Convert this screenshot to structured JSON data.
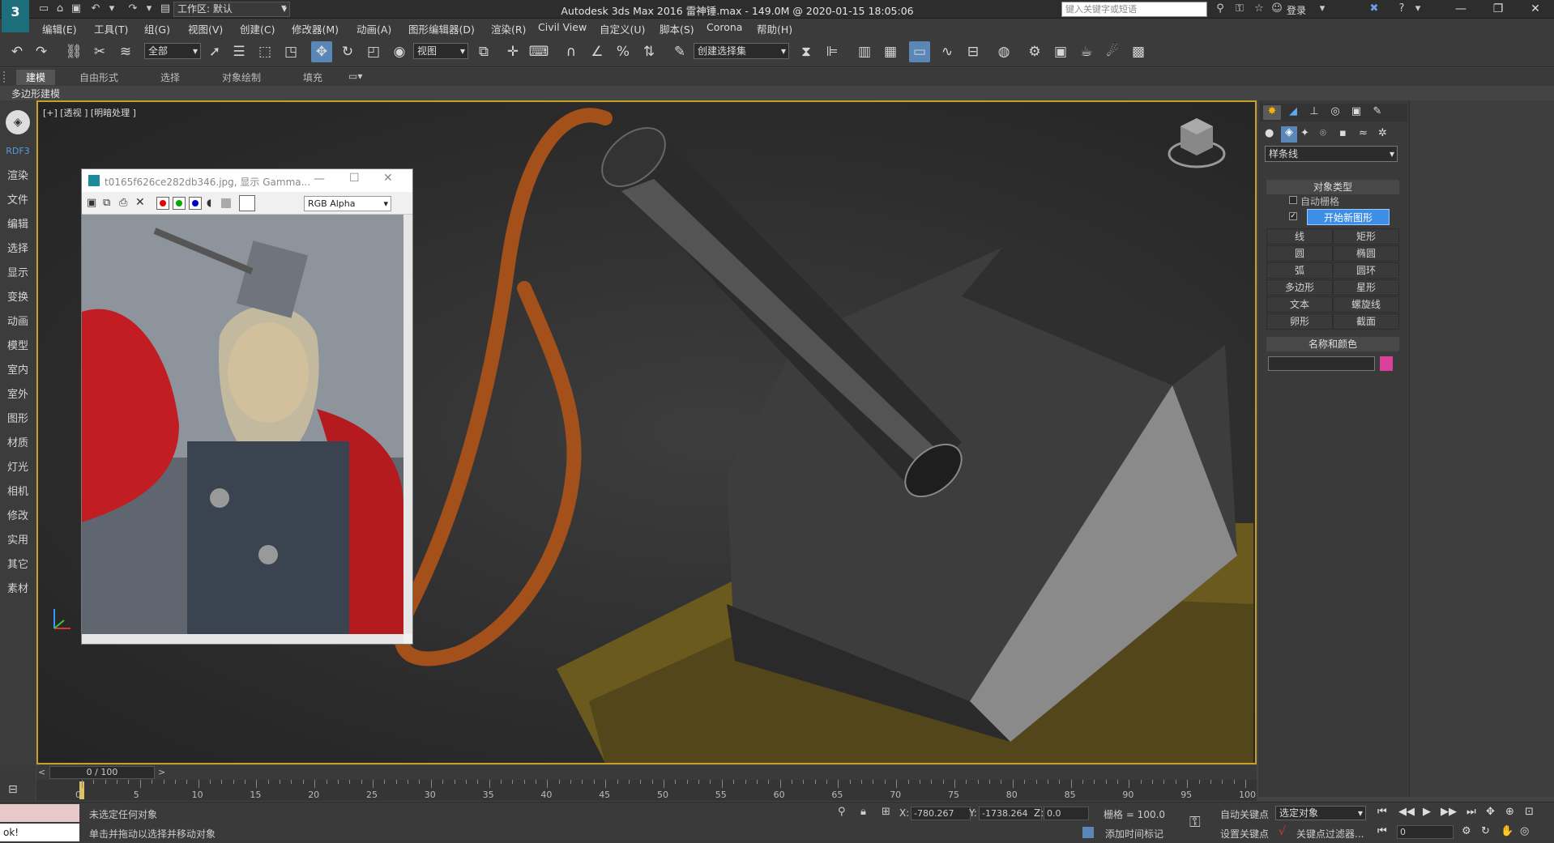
{
  "titlebar": {
    "workspace": "工作区: 默认",
    "title": "Autodesk 3ds Max 2016     雷神锤.max - 149.0M @ 2020-01-15 18:05:06",
    "search_placeholder": "键入关键字或短语",
    "login": "登录"
  },
  "menubar": [
    "编辑(E)",
    "工具(T)",
    "组(G)",
    "视图(V)",
    "创建(C)",
    "修改器(M)",
    "动画(A)",
    "图形编辑器(D)",
    "渲染(R)",
    "Civil View",
    "自定义(U)",
    "脚本(S)",
    "Corona",
    "帮助(H)"
  ],
  "toolbar": {
    "filter_select": "全部",
    "ref_coord": "视图",
    "named_sel": "创建选择集"
  },
  "ribbon": {
    "tabs": [
      "建模",
      "自由形式",
      "选择",
      "对象绘制",
      "填充"
    ],
    "sub_label": "多边形建模"
  },
  "leftbar": {
    "top_label": "RDF3",
    "items": [
      "渲染",
      "文件",
      "编辑",
      "选择",
      "显示",
      "变换",
      "动画",
      "模型",
      "室内",
      "室外",
      "图形",
      "材质",
      "灯光",
      "相机",
      "修改",
      "实用",
      "其它",
      "素材"
    ]
  },
  "viewport": {
    "label": "[+] [透视 ] [明暗处理 ]"
  },
  "image_window": {
    "caption": "t0165f626ce282db346.jpg, 显示 Gamma...",
    "channel": "RGB Alpha"
  },
  "command_panel": {
    "category": "样条线",
    "object_type_title": "对象类型",
    "auto_grid": "自动栅格",
    "start_new_shape": "开始新图形",
    "buttons": [
      "线",
      "矩形",
      "圆",
      "椭圆",
      "弧",
      "圆环",
      "多边形",
      "星形",
      "文本",
      "螺旋线",
      "卵形",
      "截面"
    ],
    "name_color_title": "名称和颜色",
    "object_color": "#d9409a"
  },
  "timeline": {
    "frame_label": "0 / 100",
    "ticks": [
      "0",
      "5",
      "10",
      "15",
      "20",
      "25",
      "30",
      "35",
      "40",
      "45",
      "50",
      "55",
      "60",
      "65",
      "70",
      "75",
      "80",
      "85",
      "90",
      "95",
      "100"
    ]
  },
  "status": {
    "maxscript": "ok!",
    "line1": "未选定任何对象",
    "line2": "单击并拖动以选择并移动对象",
    "x_label": "X:",
    "x_val": "-780.267",
    "y_label": "Y:",
    "y_val": "-1738.264",
    "z_label": "Z:",
    "z_val": "0.0",
    "grid": "栅格 = 100.0",
    "add_time_tag": "添加时间标记",
    "auto_key": "自动关键点",
    "set_key": "设置关键点",
    "key_select": "选定对象",
    "key_filters": "关键点过滤器...",
    "frame_val": "0"
  }
}
